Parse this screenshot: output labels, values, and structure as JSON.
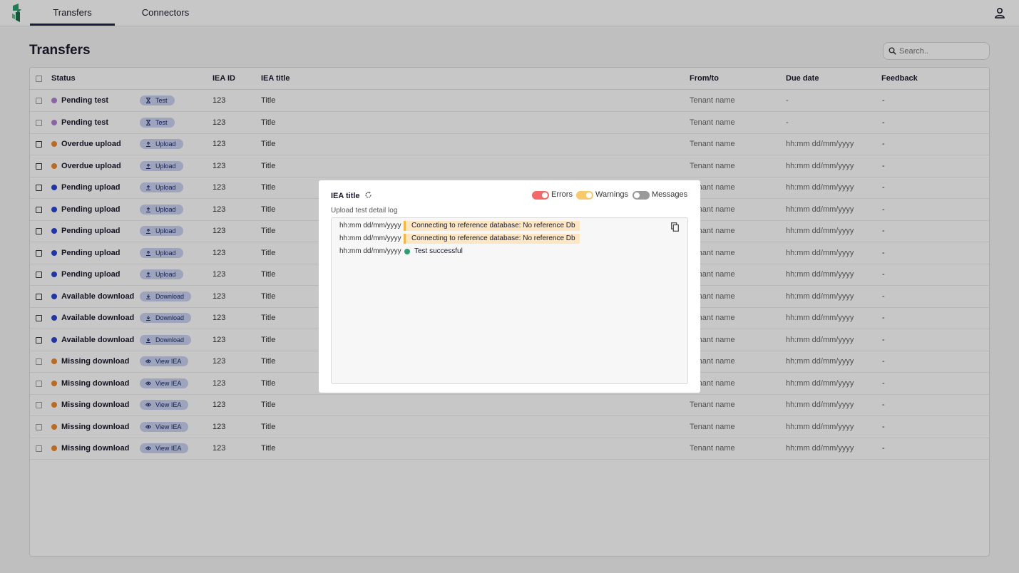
{
  "nav": {
    "tabs": [
      {
        "label": "Transfers",
        "active": true
      },
      {
        "label": "Connectors",
        "active": false
      }
    ],
    "user_icon": "user-icon",
    "logo": "app-logo"
  },
  "page": {
    "title": "Transfers",
    "search_placeholder": "Search.."
  },
  "table": {
    "headers": {
      "status": "Status",
      "iea_id": "IEA ID",
      "iea_title": "IEA title",
      "from_to": "From/to",
      "due_date": "Due date",
      "feedback": "Feedback"
    },
    "rows": [
      {
        "status": "Pending test",
        "color": "#b37fd6",
        "badge": "Test",
        "badge_icon": "hourglass-icon",
        "id": "123",
        "title": "Title",
        "from_to": "Tenant name",
        "due": "-",
        "feedback": "-",
        "checkbox_disabled": true
      },
      {
        "status": "Pending test",
        "color": "#b37fd6",
        "badge": "Test",
        "badge_icon": "hourglass-icon",
        "id": "123",
        "title": "Title",
        "from_to": "Tenant name",
        "due": "-",
        "feedback": "-",
        "checkbox_disabled": true
      },
      {
        "status": "Overdue upload",
        "color": "#ee8a2a",
        "badge": "Upload",
        "badge_icon": "upload-icon",
        "id": "123",
        "title": "Title",
        "from_to": "Tenant name",
        "due": "hh:mm dd/mm/yyyy",
        "feedback": "-",
        "checkbox_disabled": false
      },
      {
        "status": "Overdue upload",
        "color": "#ee8a2a",
        "badge": "Upload",
        "badge_icon": "upload-icon",
        "id": "123",
        "title": "Title",
        "from_to": "Tenant name",
        "due": "hh:mm dd/mm/yyyy",
        "feedback": "-",
        "checkbox_disabled": false
      },
      {
        "status": "Pending upload",
        "color": "#2b45d6",
        "badge": "Upload",
        "badge_icon": "upload-icon",
        "id": "123",
        "title": "Title",
        "from_to": "Tenant name",
        "due": "hh:mm dd/mm/yyyy",
        "feedback": "-",
        "checkbox_disabled": false
      },
      {
        "status": "Pending upload",
        "color": "#2b45d6",
        "badge": "Upload",
        "badge_icon": "upload-icon",
        "id": "123",
        "title": "Title",
        "from_to": "Tenant name",
        "due": "hh:mm dd/mm/yyyy",
        "feedback": "-",
        "checkbox_disabled": false
      },
      {
        "status": "Pending upload",
        "color": "#2b45d6",
        "badge": "Upload",
        "badge_icon": "upload-icon",
        "id": "123",
        "title": "Title",
        "from_to": "Tenant name",
        "due": "hh:mm dd/mm/yyyy",
        "feedback": "-",
        "checkbox_disabled": false
      },
      {
        "status": "Pending upload",
        "color": "#2b45d6",
        "badge": "Upload",
        "badge_icon": "upload-icon",
        "id": "123",
        "title": "Title",
        "from_to": "Tenant name",
        "due": "hh:mm dd/mm/yyyy",
        "feedback": "-",
        "checkbox_disabled": false
      },
      {
        "status": "Pending upload",
        "color": "#2b45d6",
        "badge": "Upload",
        "badge_icon": "upload-icon",
        "id": "123",
        "title": "Title",
        "from_to": "Tenant name",
        "due": "hh:mm dd/mm/yyyy",
        "feedback": "-",
        "checkbox_disabled": false
      },
      {
        "status": "Available download",
        "color": "#2b45d6",
        "badge": "Download",
        "badge_icon": "download-icon",
        "id": "123",
        "title": "Title",
        "from_to": "Tenant name",
        "due": "hh:mm dd/mm/yyyy",
        "feedback": "-",
        "checkbox_disabled": false
      },
      {
        "status": "Available download",
        "color": "#2b45d6",
        "badge": "Download",
        "badge_icon": "download-icon",
        "id": "123",
        "title": "Title",
        "from_to": "Tenant name",
        "due": "hh:mm dd/mm/yyyy",
        "feedback": "-",
        "checkbox_disabled": false
      },
      {
        "status": "Available download",
        "color": "#2b45d6",
        "badge": "Download",
        "badge_icon": "download-icon",
        "id": "123",
        "title": "Title",
        "from_to": "Tenant name",
        "due": "hh:mm dd/mm/yyyy",
        "feedback": "-",
        "checkbox_disabled": false
      },
      {
        "status": "Missing download",
        "color": "#ee8a2a",
        "badge": "View IEA",
        "badge_icon": "eye-icon",
        "id": "123",
        "title": "Title",
        "from_to": "Tenant name",
        "due": "hh:mm dd/mm/yyyy",
        "feedback": "-",
        "checkbox_disabled": true
      },
      {
        "status": "Missing download",
        "color": "#ee8a2a",
        "badge": "View IEA",
        "badge_icon": "eye-icon",
        "id": "123",
        "title": "Title",
        "from_to": "Tenant name",
        "due": "hh:mm dd/mm/yyyy",
        "feedback": "-",
        "checkbox_disabled": true
      },
      {
        "status": "Missing download",
        "color": "#ee8a2a",
        "badge": "View IEA",
        "badge_icon": "eye-icon",
        "id": "123",
        "title": "Title",
        "from_to": "Tenant name",
        "due": "hh:mm dd/mm/yyyy",
        "feedback": "-",
        "checkbox_disabled": true
      },
      {
        "status": "Missing download",
        "color": "#ee8a2a",
        "badge": "View IEA",
        "badge_icon": "eye-icon",
        "id": "123",
        "title": "Title",
        "from_to": "Tenant name",
        "due": "hh:mm dd/mm/yyyy",
        "feedback": "-",
        "checkbox_disabled": true
      },
      {
        "status": "Missing download",
        "color": "#ee8a2a",
        "badge": "View IEA",
        "badge_icon": "eye-icon",
        "id": "123",
        "title": "Title",
        "from_to": "Tenant name",
        "due": "hh:mm dd/mm/yyyy",
        "feedback": "-",
        "checkbox_disabled": true
      }
    ]
  },
  "modal": {
    "title": "IEA title",
    "refresh_icon": "refresh-icon",
    "toggles": [
      {
        "label": "Errors",
        "on": true,
        "color": "#f06a6a"
      },
      {
        "label": "Warnings",
        "on": true,
        "color": "#f7c96b"
      },
      {
        "label": "Messages",
        "on": false,
        "color": "#8a8a8a"
      }
    ],
    "log_label": "Upload test detail log",
    "copy_icon": "copy-icon",
    "log": [
      {
        "time": "hh:mm dd/mm/yyyy",
        "type": "warning",
        "message": "Connecting to reference database: No reference Db"
      },
      {
        "time": "hh:mm dd/mm/yyyy",
        "type": "warning",
        "message": "Connecting to reference database: No reference Db"
      },
      {
        "time": "hh:mm dd/mm/yyyy",
        "type": "success",
        "message": "Test successful"
      }
    ]
  },
  "colors": {
    "accent": "#1c2a4a",
    "badge_bg": "#c9d3f0",
    "success": "#2f9e6e",
    "warning_bg": "#fde7c3"
  }
}
